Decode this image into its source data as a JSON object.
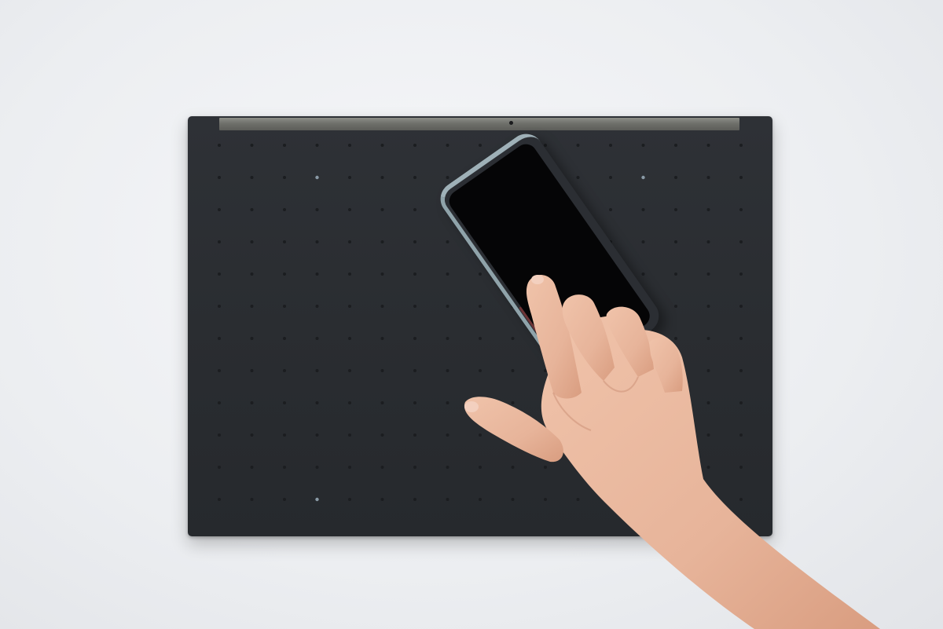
{
  "scene": {
    "background_color": "#eceef1",
    "board": {
      "color": "#2a2d31",
      "rail_color": "#6f706b",
      "dot_color": "#1b1d20",
      "indicator_color": "#8a9aa6",
      "dot_rows": 13,
      "dot_cols": 17
    },
    "phone": {
      "screen_color": "#050506",
      "case_color": "#2b2e33",
      "bumper_color": "#9fb1b8"
    },
    "hand": {
      "skin_color": "#e7b49a",
      "shadow_color": "#c98d73"
    }
  }
}
